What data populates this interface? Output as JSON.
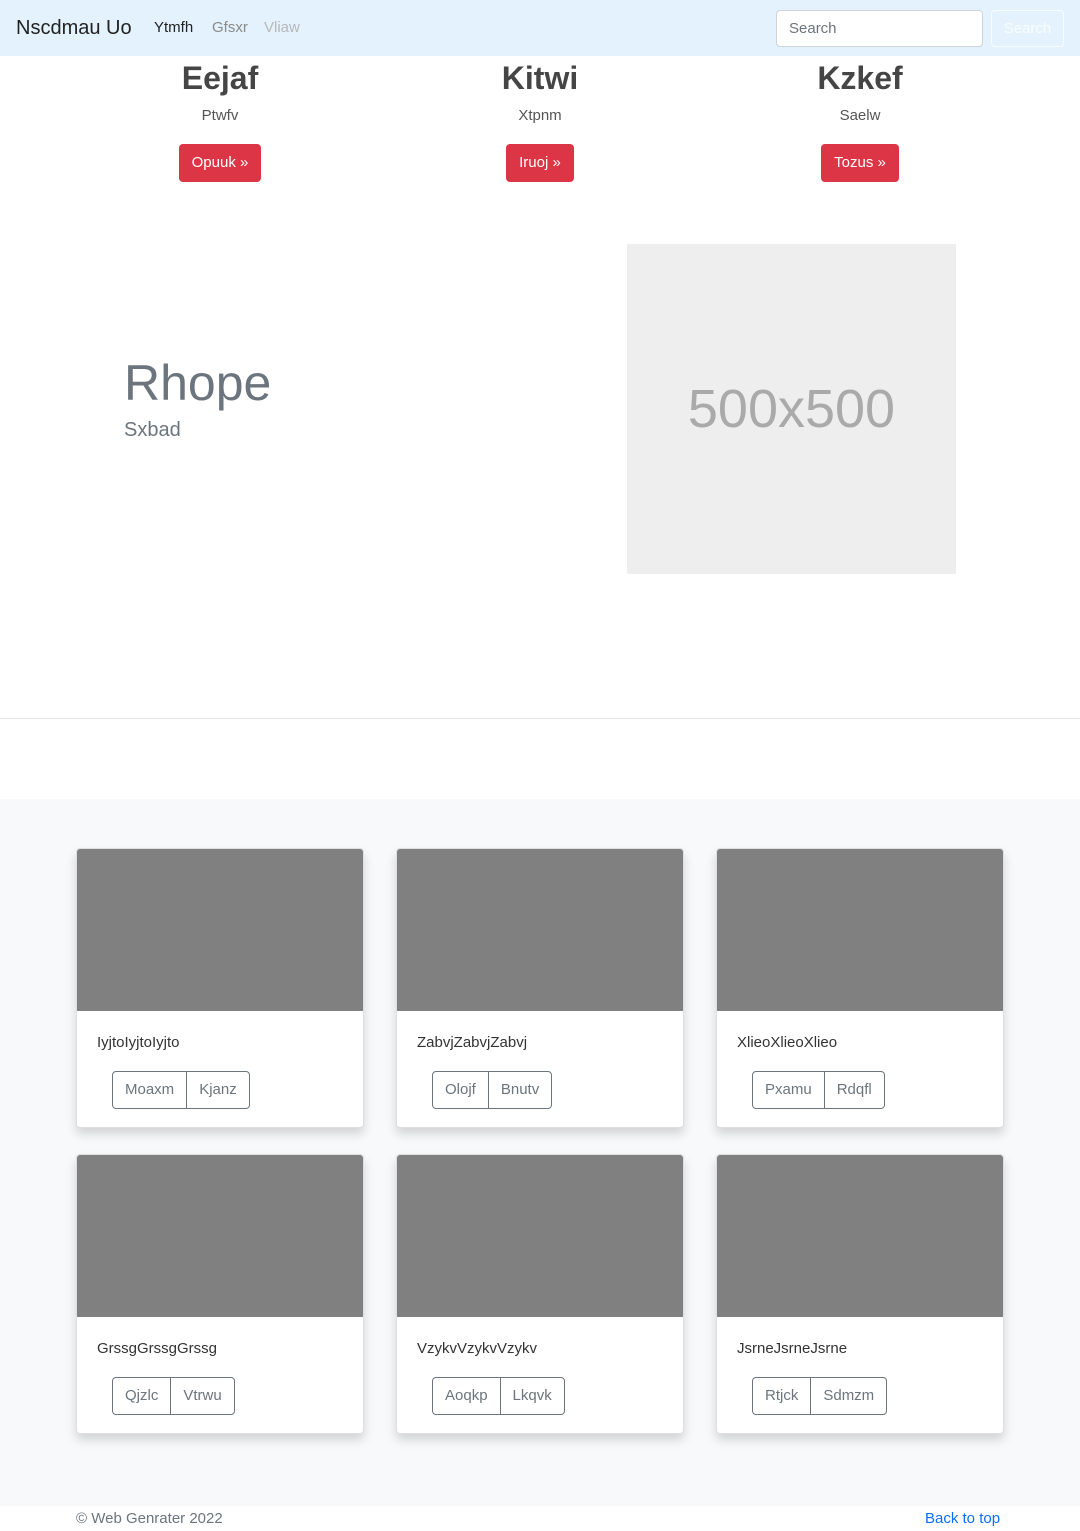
{
  "navbar": {
    "brand": "Nscdmau Uo",
    "links": [
      "Ytmfh",
      "Gfsxr",
      "Vliaw"
    ],
    "search_placeholder": "Search",
    "search_button": "Search"
  },
  "columns": [
    {
      "title": "Eejaf",
      "text": "Ptwfv",
      "button": "Opuuk »"
    },
    {
      "title": "Kitwi",
      "text": "Xtpnm",
      "button": "Iruoj »"
    },
    {
      "title": "Kzkef",
      "text": "Saelw",
      "button": "Tozus »"
    }
  ],
  "feature": {
    "heading": "Rhope",
    "subheading": "Sxbad",
    "image_label": "500x500"
  },
  "cards": [
    {
      "text": "IyjtoIyjtoIyjto",
      "buttons": [
        "Moaxm",
        "Kjanz"
      ]
    },
    {
      "text": "ZabvjZabvjZabvj",
      "buttons": [
        "Olojf",
        "Bnutv"
      ]
    },
    {
      "text": "XlieoXlieoXlieo",
      "buttons": [
        "Pxamu",
        "Rdqfl"
      ]
    },
    {
      "text": "GrssgGrssgGrssg",
      "buttons": [
        "Qjzlc",
        "Vtrwu"
      ]
    },
    {
      "text": "VzykvVzykvVzykv",
      "buttons": [
        "Aoqkp",
        "Lkqvk"
      ]
    },
    {
      "text": "JsrneJsrneJsrne",
      "buttons": [
        "Rtjck",
        "Sdmzm"
      ]
    }
  ],
  "footer": {
    "copyright": "© Web Genrater 2022",
    "back_to_top": "Back to top"
  },
  "colors": {
    "navbar_bg": "#e3f2fd",
    "danger": "#dc3545",
    "album_bg": "#f8f9fa",
    "card_image": "#808080",
    "link": "#0d6efd"
  }
}
